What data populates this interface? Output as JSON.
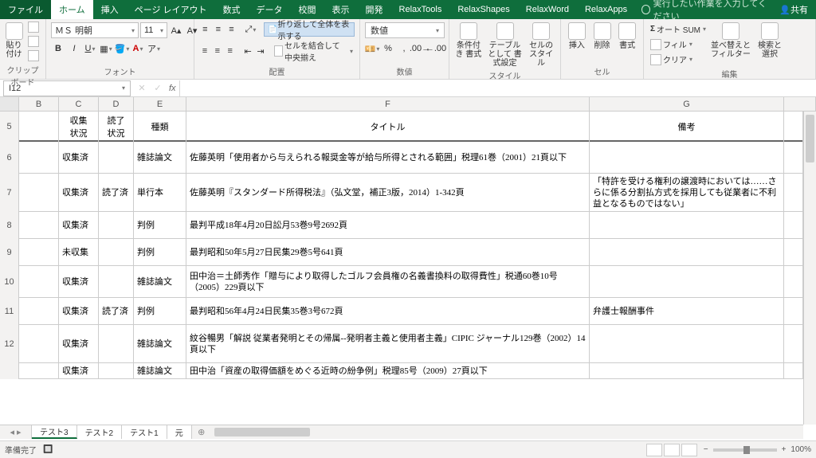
{
  "tabs": {
    "file": "ファイル",
    "home": "ホーム",
    "insert": "挿入",
    "layout": "ページ レイアウト",
    "formulas": "数式",
    "data": "データ",
    "review": "校閲",
    "view": "表示",
    "dev": "開発",
    "rt": "RelaxTools",
    "rs": "RelaxShapes",
    "rw": "RelaxWord",
    "ra": "RelaxApps"
  },
  "tellme": "実行したい作業を入力してください",
  "share": "共有",
  "clipboard": {
    "label": "クリップボード",
    "paste": "貼り付け"
  },
  "font": {
    "label": "フォント",
    "name": "ＭＳ 明朝",
    "size": "11"
  },
  "align": {
    "label": "配置",
    "wrap": "折り返して全体を表示する",
    "merge": "セルを結合して中央揃え"
  },
  "num": {
    "label": "数値",
    "fmt": "数値"
  },
  "styles": {
    "label": "スタイル",
    "cond": "条件付き\n書式",
    "tbl": "テーブルとして\n書式設定",
    "cell": "セルの\nスタイル"
  },
  "cells": {
    "label": "セル",
    "ins": "挿入",
    "del": "削除",
    "fmt": "書式"
  },
  "edit": {
    "label": "編集",
    "sum": "オート SUM",
    "fill": "フィル",
    "clear": "クリア",
    "sort": "並べ替えと\nフィルター",
    "find": "検索と\n選択"
  },
  "namebox": "I12",
  "cols": {
    "A": "",
    "B": "B",
    "C": "C",
    "D": "D",
    "E": "E",
    "F": "F",
    "G": "G"
  },
  "hdr": {
    "C": "収集\n状況",
    "D": "読了\n状況",
    "E": "種類",
    "F": "タイトル",
    "G": "備考"
  },
  "rows": [
    {
      "n": "5"
    },
    {
      "n": "6",
      "C": "収集済",
      "D": "",
      "E": "雑誌論文",
      "F": "佐藤英明「使用者から与えられる報奨金等が給与所得とされる範囲」税理61巻（2001）21頁以下",
      "G": ""
    },
    {
      "n": "7",
      "C": "収集済",
      "D": "読了済",
      "E": "単行本",
      "F": "佐藤英明『スタンダード所得税法』（弘文堂，補正3版，2014）1-342頁",
      "G": "「特許を受ける権利の譲渡時においては……さらに係る分割払方式を採用しても従業者に不利益となるものではない」"
    },
    {
      "n": "8",
      "C": "収集済",
      "D": "",
      "E": "判例",
      "F": "最判平成18年4月20日訟月53巻9号2692頁",
      "G": ""
    },
    {
      "n": "9",
      "C": "未収集",
      "D": "",
      "E": "判例",
      "F": "最判昭和50年5月27日民集29巻5号641頁",
      "G": ""
    },
    {
      "n": "10",
      "C": "収集済",
      "D": "",
      "E": "雑誌論文",
      "F": "田中治＝土師秀作「贈与により取得したゴルフ会員権の名義書換料の取得費性」税通60巻10号（2005）229頁以下",
      "G": ""
    },
    {
      "n": "11",
      "C": "収集済",
      "D": "読了済",
      "E": "判例",
      "F": "最判昭和56年4月24日民集35巻3号672頁",
      "G": "弁護士報酬事件"
    },
    {
      "n": "12",
      "C": "収集済",
      "D": "",
      "E": "雑誌論文",
      "F": "紋谷暢男「解説 従業者発明とその帰属--発明者主義と使用者主義」CIPIC ジャーナル129巻（2002）14頁以下",
      "G": ""
    },
    {
      "n": "",
      "C": "収集済",
      "D": "",
      "E": "雑誌論文",
      "F": "田中治「資産の取得価額をめぐる近時の紛争例」税理85号（2009）27頁以下",
      "G": ""
    }
  ],
  "sheets": {
    "s1": "テスト3",
    "s2": "テスト2",
    "s3": "テスト1",
    "s4": "元"
  },
  "status": {
    "ready": "準備完了",
    "zoom": "100%"
  }
}
